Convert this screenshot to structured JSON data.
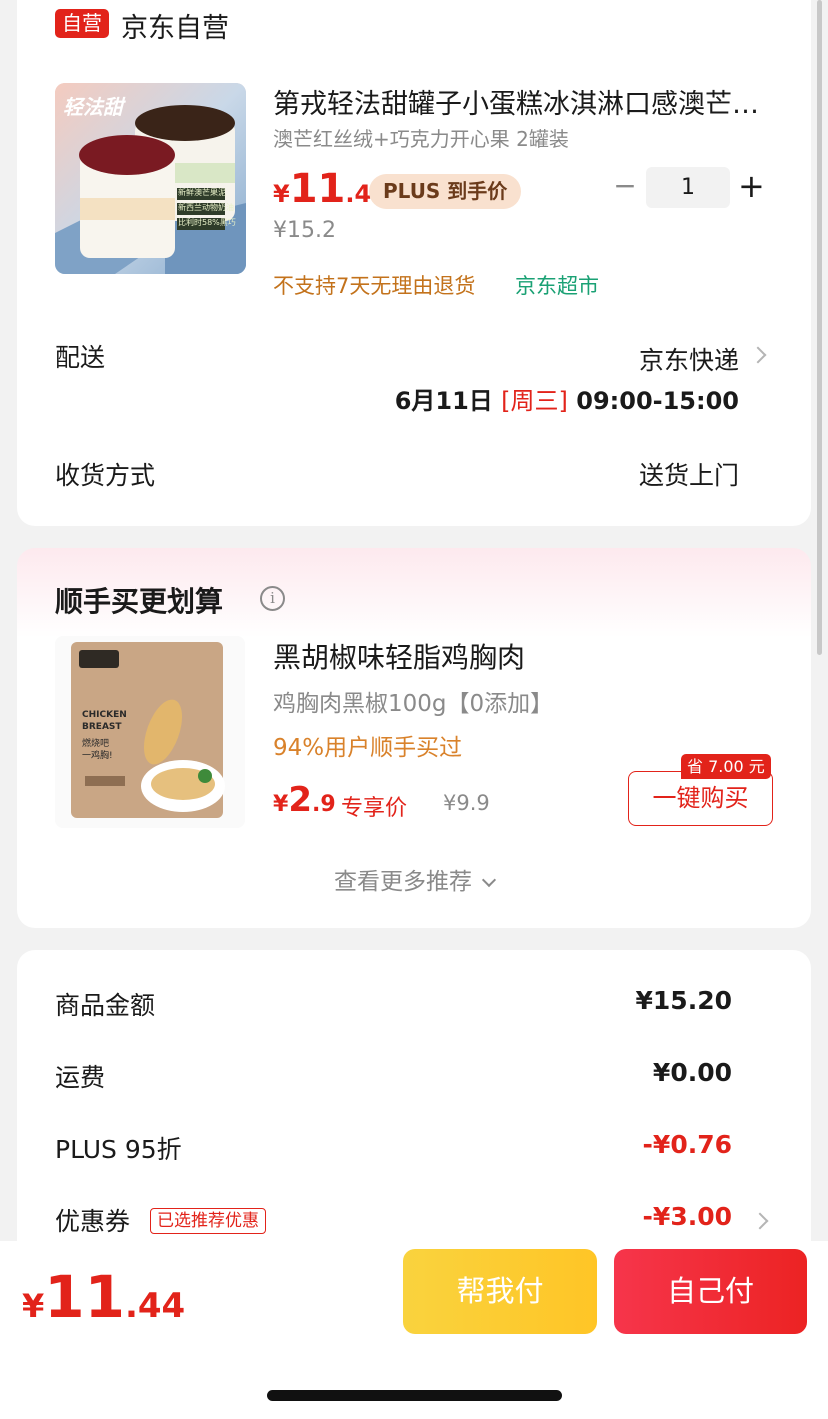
{
  "shop": {
    "badge": "自营",
    "name": "京东自营"
  },
  "product": {
    "title": "第戎轻法甜罐子小蛋糕冰淇淋口感澳芒…",
    "spec": "澳芒红丝绒+巧克力开心果 2罐装",
    "price_symbol": "¥",
    "price_int": "11",
    "price_dec": ".44",
    "plus_tag": "PLUS 到手价",
    "original_price": "¥15.2",
    "qty_minus": "−",
    "quantity": "1",
    "qty_plus": "+",
    "return_policy": "不支持7天无理由退货",
    "store_tag": "京东超市",
    "image_text": {
      "brand": "轻法甜",
      "tag1": "新鲜澳芒果泥",
      "tag2": "新西兰动物奶油",
      "tag3": "比利时58%黑巧"
    }
  },
  "delivery": {
    "label": "配送",
    "method": "京东快递",
    "date": "6月11日",
    "weekday": "[周三]",
    "time": "09:00-15:00",
    "receive_label": "收货方式",
    "receive_value": "送货上门"
  },
  "recommend": {
    "title": "顺手买更划算",
    "info_icon": "i",
    "item_name": "黑胡椒味轻脂鸡胸肉",
    "item_spec": "鸡胸肉黑椒100g【0添加】",
    "item_percent": "94%用户顺手买过",
    "price_symbol": "¥",
    "price_int": "2",
    "price_dec": ".9",
    "exclusive": "专享价",
    "original_price": "¥9.9",
    "buy_button": "一键购买",
    "save_tag": "省 7.00 元",
    "more": "查看更多推荐",
    "image_text": {
      "line1": "CHICKEN",
      "line2": "BREAST",
      "line3": "燃烧吧",
      "line4": "一鸡胸!"
    }
  },
  "summary": {
    "rows": [
      {
        "label": "商品金额",
        "value": "¥15.20",
        "red": false
      },
      {
        "label": "运费",
        "value": "¥0.00",
        "red": false
      },
      {
        "label": "PLUS 95折",
        "value": "-¥0.76",
        "red": true
      },
      {
        "label": "优惠券",
        "value": "-¥3.00",
        "red": true
      }
    ],
    "coupon_tag": "已选推荐优惠"
  },
  "footer": {
    "price_symbol": "¥",
    "price_int": "11",
    "price_dec": ".44",
    "pay_help": "帮我付",
    "pay_self": "自己付"
  },
  "colors": {
    "accent_red": "#e2231a",
    "green": "#1aa174",
    "orange": "#c3721b",
    "yellow": "#f9d33e"
  }
}
